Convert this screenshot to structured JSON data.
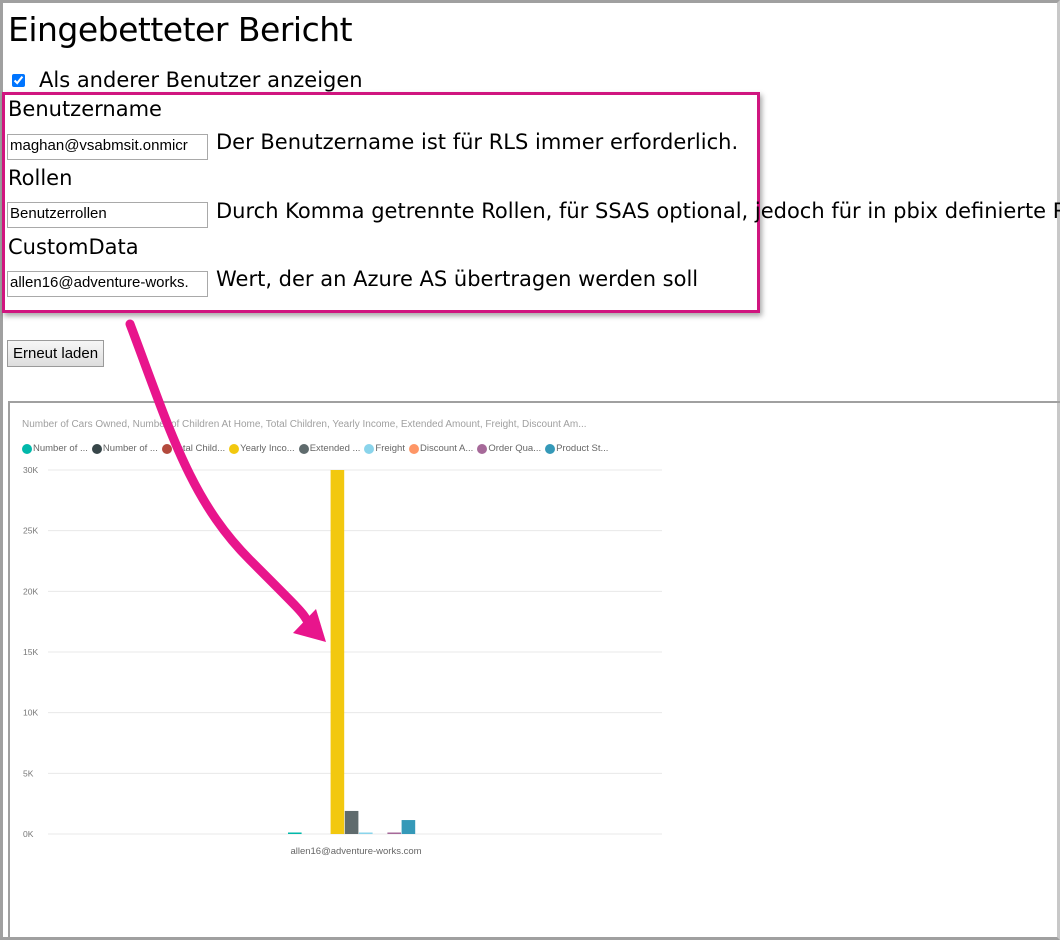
{
  "page": {
    "title": "Eingebetteter Bericht",
    "checkbox_label": "Als anderer Benutzer anzeigen",
    "checkbox_checked": true
  },
  "form": {
    "username_label": "Benutzername",
    "username_value": "maghan@vsabmsit.onmicr",
    "username_hint": "Der Benutzername ist für RLS immer erforderlich.",
    "roles_label": "Rollen",
    "roles_value": "Benutzerrollen",
    "roles_hint": "Durch Komma getrennte Rollen, für SSAS optional, jedoch für in pbix definierte R",
    "customdata_label": "CustomData",
    "customdata_value": "allen16@adventure-works.",
    "customdata_hint": "Wert, der an Azure AS übertragen werden soll",
    "reload_label": "Erneut laden"
  },
  "colors": {
    "highlight": "#d0157f"
  },
  "chart_data": {
    "type": "bar",
    "title": "Number of Cars Owned, Number of Children At Home, Total Children, Yearly Income, Extended Amount, Freight, Discount Am...",
    "categories": [
      "allen16@adventure-works.com"
    ],
    "ylim": [
      0,
      30000
    ],
    "yticks": [
      "0K",
      "5K",
      "10K",
      "15K",
      "20K",
      "25K",
      "30K"
    ],
    "series": [
      {
        "name": "Number of ...",
        "color": "#01b8aa",
        "values": [
          100
        ]
      },
      {
        "name": "Number of ...",
        "color": "#374649",
        "values": [
          0
        ]
      },
      {
        "name": "Total Child...",
        "color": "#b34a3d",
        "values": [
          0
        ]
      },
      {
        "name": "Yearly Inco...",
        "color": "#f2c80f",
        "values": [
          30000
        ]
      },
      {
        "name": "Extended ...",
        "color": "#5f6b6d",
        "values": [
          1900
        ]
      },
      {
        "name": "Freight",
        "color": "#8ad4eb",
        "values": [
          50
        ]
      },
      {
        "name": "Discount A...",
        "color": "#fe9666",
        "values": [
          0
        ]
      },
      {
        "name": "Order Qua...",
        "color": "#a66999",
        "values": [
          80
        ]
      },
      {
        "name": "Product St...",
        "color": "#3599b8",
        "values": [
          1150
        ]
      }
    ]
  }
}
